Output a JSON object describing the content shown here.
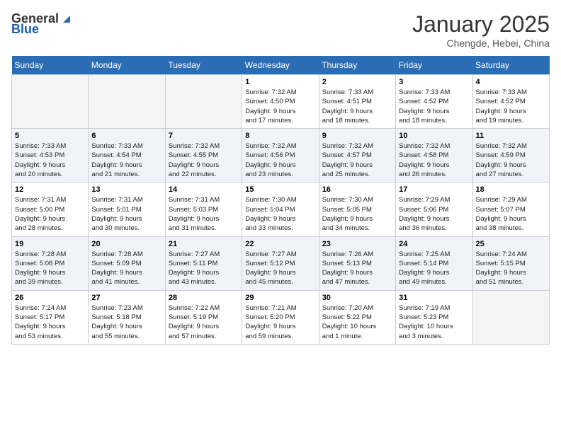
{
  "header": {
    "logo_general": "General",
    "logo_blue": "Blue",
    "month": "January 2025",
    "location": "Chengde, Hebei, China"
  },
  "weekdays": [
    "Sunday",
    "Monday",
    "Tuesday",
    "Wednesday",
    "Thursday",
    "Friday",
    "Saturday"
  ],
  "weeks": [
    [
      {
        "day": "",
        "info": ""
      },
      {
        "day": "",
        "info": ""
      },
      {
        "day": "",
        "info": ""
      },
      {
        "day": "1",
        "info": "Sunrise: 7:32 AM\nSunset: 4:50 PM\nDaylight: 9 hours\nand 17 minutes."
      },
      {
        "day": "2",
        "info": "Sunrise: 7:33 AM\nSunset: 4:51 PM\nDaylight: 9 hours\nand 18 minutes."
      },
      {
        "day": "3",
        "info": "Sunrise: 7:33 AM\nSunset: 4:52 PM\nDaylight: 9 hours\nand 18 minutes."
      },
      {
        "day": "4",
        "info": "Sunrise: 7:33 AM\nSunset: 4:52 PM\nDaylight: 9 hours\nand 19 minutes."
      }
    ],
    [
      {
        "day": "5",
        "info": "Sunrise: 7:33 AM\nSunset: 4:53 PM\nDaylight: 9 hours\nand 20 minutes."
      },
      {
        "day": "6",
        "info": "Sunrise: 7:33 AM\nSunset: 4:54 PM\nDaylight: 9 hours\nand 21 minutes."
      },
      {
        "day": "7",
        "info": "Sunrise: 7:32 AM\nSunset: 4:55 PM\nDaylight: 9 hours\nand 22 minutes."
      },
      {
        "day": "8",
        "info": "Sunrise: 7:32 AM\nSunset: 4:56 PM\nDaylight: 9 hours\nand 23 minutes."
      },
      {
        "day": "9",
        "info": "Sunrise: 7:32 AM\nSunset: 4:57 PM\nDaylight: 9 hours\nand 25 minutes."
      },
      {
        "day": "10",
        "info": "Sunrise: 7:32 AM\nSunset: 4:58 PM\nDaylight: 9 hours\nand 26 minutes."
      },
      {
        "day": "11",
        "info": "Sunrise: 7:32 AM\nSunset: 4:59 PM\nDaylight: 9 hours\nand 27 minutes."
      }
    ],
    [
      {
        "day": "12",
        "info": "Sunrise: 7:31 AM\nSunset: 5:00 PM\nDaylight: 9 hours\nand 28 minutes."
      },
      {
        "day": "13",
        "info": "Sunrise: 7:31 AM\nSunset: 5:01 PM\nDaylight: 9 hours\nand 30 minutes."
      },
      {
        "day": "14",
        "info": "Sunrise: 7:31 AM\nSunset: 5:03 PM\nDaylight: 9 hours\nand 31 minutes."
      },
      {
        "day": "15",
        "info": "Sunrise: 7:30 AM\nSunset: 5:04 PM\nDaylight: 9 hours\nand 33 minutes."
      },
      {
        "day": "16",
        "info": "Sunrise: 7:30 AM\nSunset: 5:05 PM\nDaylight: 9 hours\nand 34 minutes."
      },
      {
        "day": "17",
        "info": "Sunrise: 7:29 AM\nSunset: 5:06 PM\nDaylight: 9 hours\nand 36 minutes."
      },
      {
        "day": "18",
        "info": "Sunrise: 7:29 AM\nSunset: 5:07 PM\nDaylight: 9 hours\nand 38 minutes."
      }
    ],
    [
      {
        "day": "19",
        "info": "Sunrise: 7:28 AM\nSunset: 5:08 PM\nDaylight: 9 hours\nand 39 minutes."
      },
      {
        "day": "20",
        "info": "Sunrise: 7:28 AM\nSunset: 5:09 PM\nDaylight: 9 hours\nand 41 minutes."
      },
      {
        "day": "21",
        "info": "Sunrise: 7:27 AM\nSunset: 5:11 PM\nDaylight: 9 hours\nand 43 minutes."
      },
      {
        "day": "22",
        "info": "Sunrise: 7:27 AM\nSunset: 5:12 PM\nDaylight: 9 hours\nand 45 minutes."
      },
      {
        "day": "23",
        "info": "Sunrise: 7:26 AM\nSunset: 5:13 PM\nDaylight: 9 hours\nand 47 minutes."
      },
      {
        "day": "24",
        "info": "Sunrise: 7:25 AM\nSunset: 5:14 PM\nDaylight: 9 hours\nand 49 minutes."
      },
      {
        "day": "25",
        "info": "Sunrise: 7:24 AM\nSunset: 5:15 PM\nDaylight: 9 hours\nand 51 minutes."
      }
    ],
    [
      {
        "day": "26",
        "info": "Sunrise: 7:24 AM\nSunset: 5:17 PM\nDaylight: 9 hours\nand 53 minutes."
      },
      {
        "day": "27",
        "info": "Sunrise: 7:23 AM\nSunset: 5:18 PM\nDaylight: 9 hours\nand 55 minutes."
      },
      {
        "day": "28",
        "info": "Sunrise: 7:22 AM\nSunset: 5:19 PM\nDaylight: 9 hours\nand 57 minutes."
      },
      {
        "day": "29",
        "info": "Sunrise: 7:21 AM\nSunset: 5:20 PM\nDaylight: 9 hours\nand 59 minutes."
      },
      {
        "day": "30",
        "info": "Sunrise: 7:20 AM\nSunset: 5:22 PM\nDaylight: 10 hours\nand 1 minute."
      },
      {
        "day": "31",
        "info": "Sunrise: 7:19 AM\nSunset: 5:23 PM\nDaylight: 10 hours\nand 3 minutes."
      },
      {
        "day": "",
        "info": ""
      }
    ]
  ]
}
